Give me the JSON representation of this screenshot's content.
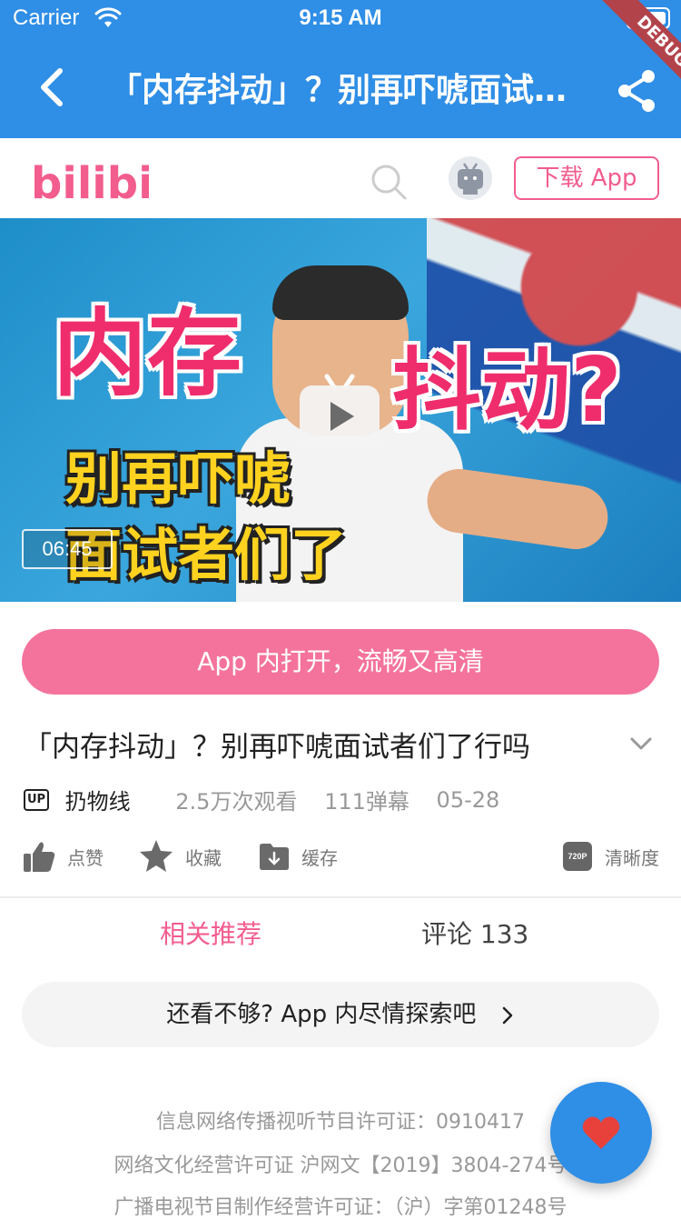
{
  "status_bar": {
    "carrier": "Carrier",
    "time": "9:15 AM"
  },
  "app_bar": {
    "title": "「内存抖动」？别再吓唬面试者们了行吗",
    "debug_label": "DEBUG"
  },
  "header": {
    "logo_text": "bilibili",
    "download_label": "下载 App"
  },
  "video": {
    "caption_line1": "内存",
    "caption_line2": "抖动?",
    "caption_line3": "别再吓唬",
    "caption_line4": "面试者们了",
    "duration": "06:45"
  },
  "open_app_label": "App 内打开，流畅又高清",
  "title": "「内存抖动」？别再吓唬面试者们了行吗",
  "meta": {
    "up_badge": "UP",
    "uploader": "扔物线",
    "views": "2.5万次观看",
    "danmaku": "111弹幕",
    "date": "05-28"
  },
  "actions": {
    "like": "点赞",
    "favorite": "收藏",
    "cache": "缓存",
    "quality_badge": "720P",
    "quality": "清晰度"
  },
  "tabs": {
    "related": "相关推荐",
    "comments": "评论 133"
  },
  "explore_label": "还看不够? App 内尽情探索吧",
  "footer": [
    "信息网络传播视听节目许可证：0910417",
    "网络文化经营许可证 沪网文【2019】3804-274号",
    "广播电视节目制作经营许可证：（沪）字第01248号"
  ],
  "colors": {
    "primary": "#2f8ee6",
    "bili_pink": "#f25d8e",
    "button_pink": "#f4739c",
    "fab_heart": "#e8413c"
  }
}
